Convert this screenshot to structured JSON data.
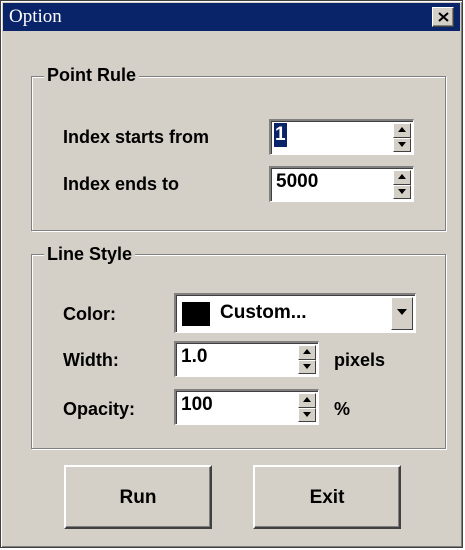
{
  "window": {
    "title": "Option"
  },
  "point_rule": {
    "legend": "Point Rule",
    "index_start_label": "Index starts from",
    "index_start_value": "1",
    "index_end_label": "Index ends to",
    "index_end_value": "5000"
  },
  "line_style": {
    "legend": "Line Style",
    "color_label": "Color:",
    "color_value": "Custom...",
    "color_swatch": "#000000",
    "width_label": "Width:",
    "width_value": "1.0",
    "width_unit": "pixels",
    "opacity_label": "Opacity:",
    "opacity_value": "100",
    "opacity_unit": "%"
  },
  "buttons": {
    "run": "Run",
    "exit": "Exit"
  },
  "icons": {
    "close": "close-icon",
    "spin_up": "arrow-up-icon",
    "spin_down": "arrow-down-icon",
    "dropdown": "chevron-down-icon"
  }
}
